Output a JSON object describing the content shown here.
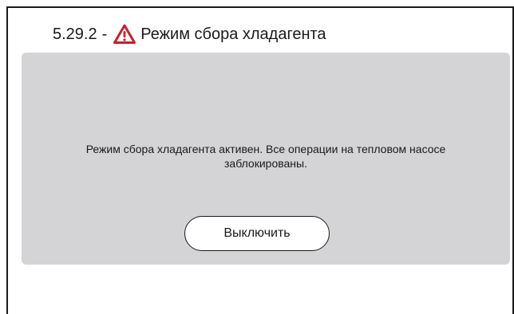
{
  "header": {
    "code": "5.29.2",
    "separator": "-",
    "title": "Режим сбора хладагента",
    "icon": "warning-triangle-icon",
    "icon_color": "#c8202a"
  },
  "panel": {
    "message": "Режим сбора хладагента активен. Все операции на тепловом насосе заблокированы.",
    "button_label": "Выключить",
    "background": "#d4d4d6"
  }
}
